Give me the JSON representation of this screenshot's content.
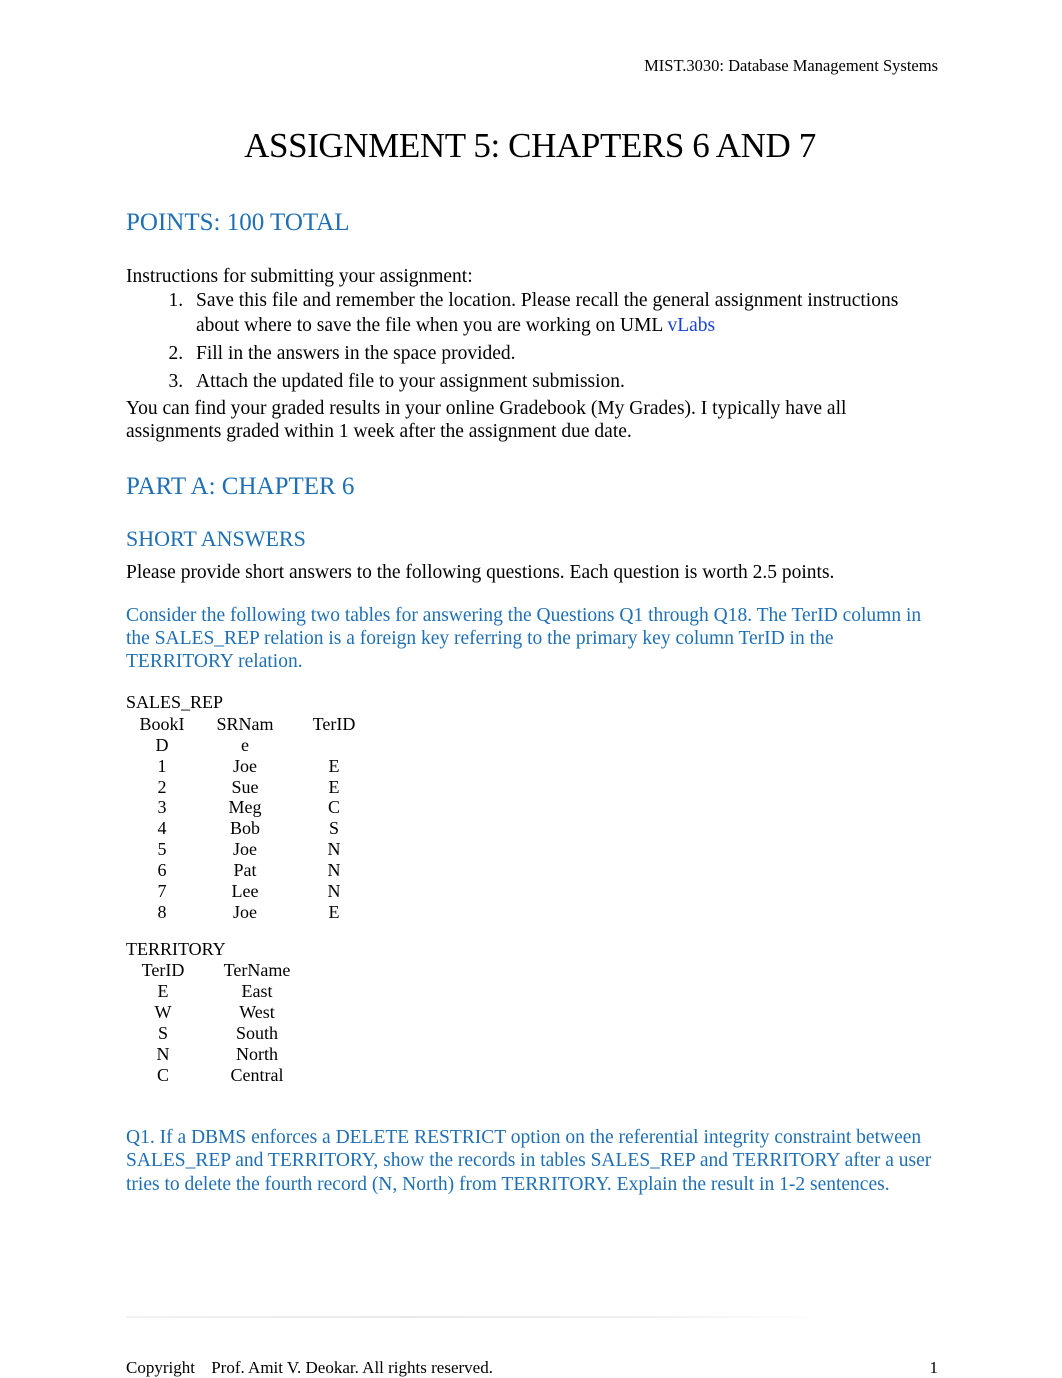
{
  "header": {
    "course": "MIST.3030: Database Management Systems"
  },
  "title": {
    "text": "ASSIGNMENT 5: CHAPTERS 6 AND 7"
  },
  "points": {
    "label": "POINTS: 100",
    "suffix": " TOTAL"
  },
  "instructions": {
    "lead": "Instructions for submitting your assignment:",
    "items": [
      {
        "text_before": "Save this file and remember the location. Please recall the general assignment instructions about where to save the file when you are working on UML ",
        "link": "vLabs",
        "text_after": ""
      },
      {
        "text_before": "Fill in the answers in the space provided.",
        "link": "",
        "text_after": ""
      },
      {
        "text_before": "Attach the updated file to your assignment submission.",
        "link": "",
        "text_after": ""
      }
    ]
  },
  "gradebook": {
    "text": "You can find your graded results in your online Gradebook (My Grades). I typically have all assignments graded within 1 week after the assignment due date."
  },
  "part_a": {
    "prefix": "PART A: ",
    "chapter": "CHAPTER 6"
  },
  "short_answers": {
    "heading": "SHORT ANSWERS",
    "intro": "Please provide short answers to the following questions. Each question is worth 2.5 points.",
    "blue_note": "Consider the following two tables for answering the Questions Q1  through Q18. The TerID column in the SALES_REP relation is a foreign key referring to the primary key column TerID in the TERRITORY relation."
  },
  "tables": {
    "sales_rep": {
      "name": "SALES_REP",
      "columns": [
        {
          "line1": "BookI",
          "line2": "D"
        },
        {
          "line1": "SRNam",
          "line2": "e"
        },
        {
          "line1": "TerID",
          "line2": ""
        }
      ],
      "rows": [
        [
          "1",
          "Joe",
          "E"
        ],
        [
          "2",
          "Sue",
          "E"
        ],
        [
          "3",
          "Meg",
          "C"
        ],
        [
          "4",
          "Bob",
          "S"
        ],
        [
          "5",
          "Joe",
          "N"
        ],
        [
          "6",
          "Pat",
          "N"
        ],
        [
          "7",
          "Lee",
          "N"
        ],
        [
          "8",
          "Joe",
          "E"
        ]
      ]
    },
    "territory": {
      "name": "TERRITORY",
      "columns": [
        "TerID",
        "TerName"
      ],
      "rows": [
        [
          "E",
          "East"
        ],
        [
          "W",
          "West"
        ],
        [
          "S",
          "South"
        ],
        [
          "N",
          "North"
        ],
        [
          "C",
          "Central"
        ]
      ]
    }
  },
  "questions": [
    {
      "id": "Q1",
      "text": "Q1. If a DBMS enforces a DELETE RESTRICT option on the referential integrity constraint between SALES_REP and TERRITORY, show the records in tables SALES_REP and TERRITORY after a user tries to delete the fourth record (N, North) from TERRITORY. Explain the result in 1-2 sentences."
    }
  ],
  "footer": {
    "copyright": "Copyright",
    "copyright_rest": " Prof. Amit V. Deokar. All rights reserved.",
    "page_number": "1"
  },
  "colors": {
    "heading_blue": "#1F6FB5",
    "link_blue": "#1a42d8",
    "text_black": "#000000"
  }
}
